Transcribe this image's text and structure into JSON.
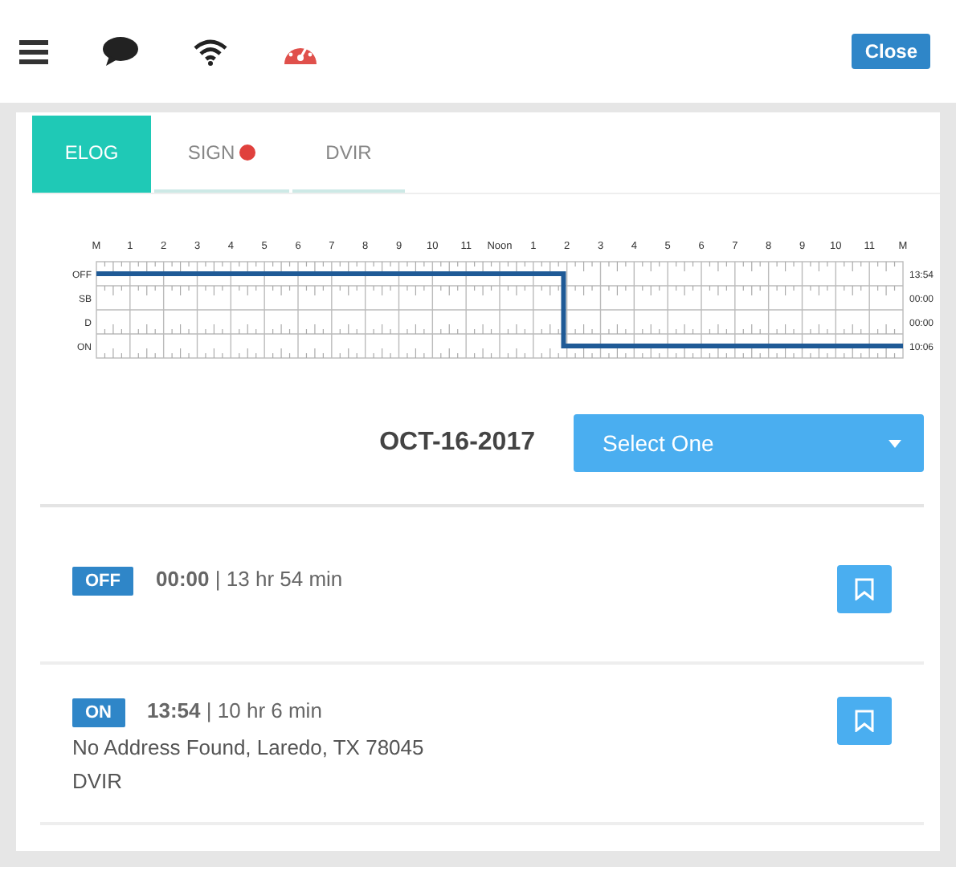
{
  "close_button": "Close",
  "tabs": [
    {
      "label": "ELOG",
      "selected": true,
      "alert": false
    },
    {
      "label": "SIGN",
      "selected": false,
      "alert": true
    },
    {
      "label": "DVIR",
      "selected": false,
      "alert": false
    }
  ],
  "log_graph": {
    "hour_labels": [
      "M",
      "1",
      "2",
      "3",
      "4",
      "5",
      "6",
      "7",
      "8",
      "9",
      "10",
      "11",
      "Noon",
      "1",
      "2",
      "3",
      "4",
      "5",
      "6",
      "7",
      "8",
      "9",
      "10",
      "11",
      "M"
    ],
    "rows": [
      {
        "label": "OFF",
        "total": "13:54"
      },
      {
        "label": "SB",
        "total": "00:00"
      },
      {
        "label": "D",
        "total": "00:00"
      },
      {
        "label": "ON",
        "total": "10:06"
      }
    ]
  },
  "date": "OCT-16-2017",
  "select": {
    "value": "Select One"
  },
  "entries": [
    {
      "status": "OFF",
      "time": "00:00",
      "separator": "|",
      "duration": "13 hr 54 min"
    },
    {
      "status": "ON",
      "time": "13:54",
      "separator": "|",
      "duration": "10 hr 6 min",
      "lines": [
        "No Address Found, Laredo, TX 78045",
        "DVIR"
      ]
    }
  ]
}
